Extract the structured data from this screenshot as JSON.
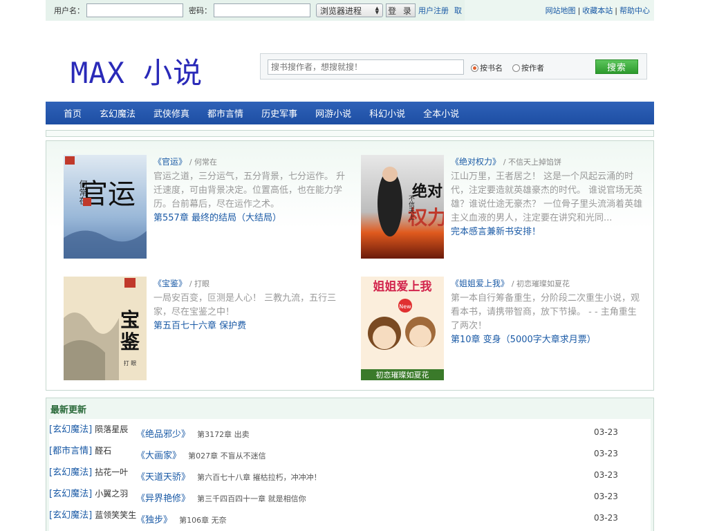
{
  "login": {
    "user_label": "用户名：",
    "pass_label": "密码：",
    "session_select": "浏览器进程",
    "login_button": "登 录",
    "register_link": "用户注册",
    "take_link": "取"
  },
  "top_links": [
    "网站地图",
    "收藏本站",
    "帮助中心"
  ],
  "logo": "MAX 小说",
  "search": {
    "placeholder": "搜书搜作者，想搜就搜！",
    "option_title": "按书名",
    "option_author": "按作者",
    "button": "搜索"
  },
  "nav": [
    "首页",
    "玄幻魔法",
    "武侠修真",
    "都市言情",
    "历史军事",
    "网游小说",
    "科幻小说",
    "全本小说"
  ],
  "featured": [
    {
      "title": "《官运》",
      "author": "/ 何常在",
      "desc": "官运之道，三分运气，五分背景，七分运作。 升迁速度，可由背景决定。位置高低，也在能力学历。台前幕后，尽在运作之术。",
      "chapter": "第557章 最终的结局（大结局）"
    },
    {
      "title": "《绝对权力》",
      "author": "/ 不信天上掉馅饼",
      "desc": "江山万里，王者居之！ 这是一个风起云涌的时代，注定要造就英雄豪杰的时代。 谁说官场无英雄？谁说仕途无豪杰？ 一位骨子里头流淌着英雄主义血液的男人，注定要在讲究和光同...",
      "chapter": "完本感言兼新书安排！"
    },
    {
      "title": "《宝鉴》",
      "author": "/ 打眼",
      "desc": "一局安百变，叵测是人心！ 三教九流，五行三家，尽在宝鉴之中！",
      "chapter": "第五百七十六章 保护费"
    },
    {
      "title": "《姐姐爱上我》",
      "author": "/ 初恋璀璨如夏花",
      "desc": "第一本自行筹备重生，分阶段二次重生小说，观看本书，请携带智商，放下节操。 - - 主角重生了两次！",
      "chapter": "第10章 变身（5000字大章求月票）"
    }
  ],
  "covers": [
    {
      "text": "官运",
      "sub": "何常在著"
    },
    {
      "text": "绝对权力",
      "sub": "不信天上掉馅饼著"
    },
    {
      "text": "宝鉴",
      "sub": "打眼著"
    },
    {
      "text": "姐姐爱上我",
      "sub": "初恋璀璨如夏花"
    }
  ],
  "latest": {
    "heading": "最新更新",
    "rows": [
      {
        "cat": "[玄幻魔法]",
        "title": "《绝品邪少》",
        "chapter": "第3172章 出卖",
        "author": "陨落星辰",
        "date": "03-23"
      },
      {
        "cat": "[都市言情]",
        "title": "《大画家》",
        "chapter": "第027章 不盲从不迷信",
        "author": "醛石",
        "date": "03-23"
      },
      {
        "cat": "[玄幻魔法]",
        "title": "《天道天骄》",
        "chapter": "第六百七十八章 摧枯拉朽，冲冲冲！",
        "author": "拈花一叶",
        "date": "03-23"
      },
      {
        "cat": "[玄幻魔法]",
        "title": "《异界艳修》",
        "chapter": "第三千四百四十一章 就是相信你",
        "author": "小翼之羽",
        "date": "03-23"
      },
      {
        "cat": "[玄幻魔法]",
        "title": "《独步》",
        "chapter": "第106章 无奈",
        "author": "蓝领笑笑生",
        "date": "03-23"
      }
    ]
  }
}
